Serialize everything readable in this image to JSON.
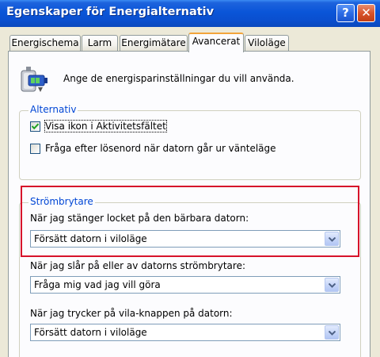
{
  "window": {
    "title": "Egenskaper för Energialternativ",
    "help_label": "?",
    "close_label": "✕"
  },
  "tabs": [
    {
      "label": "Energischema",
      "active": false
    },
    {
      "label": "Larm",
      "active": false
    },
    {
      "label": "Energimätare",
      "active": false
    },
    {
      "label": "Avancerat",
      "active": true
    },
    {
      "label": "Viloläge",
      "active": false
    }
  ],
  "intro": {
    "icon": "power-options-icon",
    "text": "Ange de energisparinställningar du vill använda."
  },
  "alternativ": {
    "legend": "Alternativ",
    "options": [
      {
        "label": "Visa ikon i Aktivitetsfältet",
        "checked": true
      },
      {
        "label": "Fråga efter lösenord när datorn går ur vänteläge",
        "checked": false
      }
    ]
  },
  "strombrytare": {
    "legend": "Strömbrytare",
    "fields": [
      {
        "label": "När jag stänger locket på den bärbara datorn:",
        "value": "Försätt datorn i viloläge"
      },
      {
        "label": "När jag slår på eller av datorns strömbrytare:",
        "value": "Fråga mig vad jag vill göra"
      },
      {
        "label": "När jag trycker på vila-knappen på datorn:",
        "value": "Försätt datorn i viloläge"
      }
    ]
  },
  "colors": {
    "titlebar": "#0a55d8",
    "legend_text": "#0046d5",
    "highlight": "#d7122a",
    "checkmark": "#21a121",
    "active_tab_accent": "#f2a43a"
  }
}
